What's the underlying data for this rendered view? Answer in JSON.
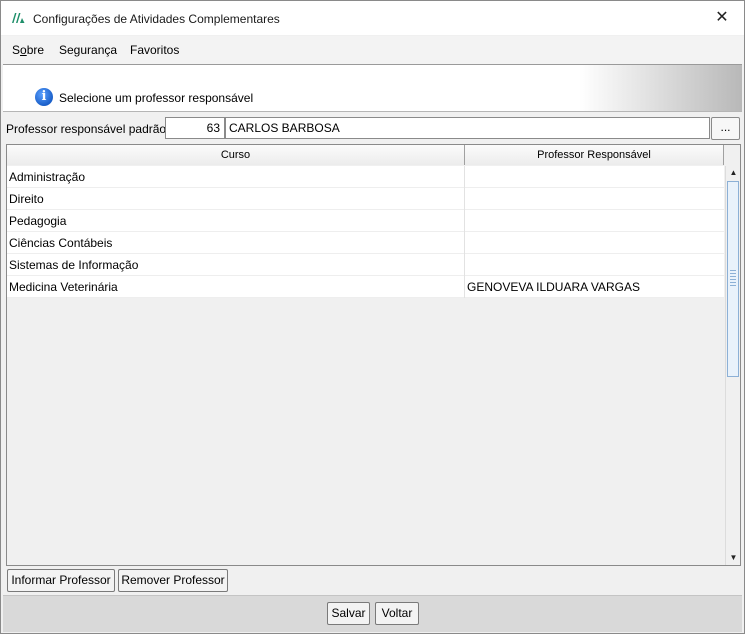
{
  "window": {
    "title": "Configurações de Atividades Complementares",
    "close_glyph": "✕"
  },
  "menu": {
    "items": [
      {
        "label": "Sobre",
        "mnemonic": "o"
      },
      {
        "label": "Segurança"
      },
      {
        "label": "Favoritos"
      }
    ]
  },
  "header": {
    "message": "Selecione um professor responsável",
    "icon": "info-icon"
  },
  "default_professor": {
    "label": "Professor responsável padrão:",
    "code": "63",
    "name": "CARLOS BARBOSA",
    "lookup_label": "..."
  },
  "grid": {
    "columns": [
      "Curso",
      "Professor Responsável"
    ],
    "rows": [
      {
        "curso": "Administração",
        "professor": ""
      },
      {
        "curso": "Direito",
        "professor": ""
      },
      {
        "curso": "Pedagogia",
        "professor": ""
      },
      {
        "curso": "Ciências Contábeis",
        "professor": ""
      },
      {
        "curso": "Sistemas de Informação",
        "professor": ""
      },
      {
        "curso": "Medicina Veterinária",
        "professor": "GENOVEVA ILDUARA VARGAS"
      }
    ]
  },
  "actions": {
    "informar": "Informar Professor",
    "remover": "Remover Professor",
    "salvar": "Salvar",
    "voltar": "Voltar"
  }
}
